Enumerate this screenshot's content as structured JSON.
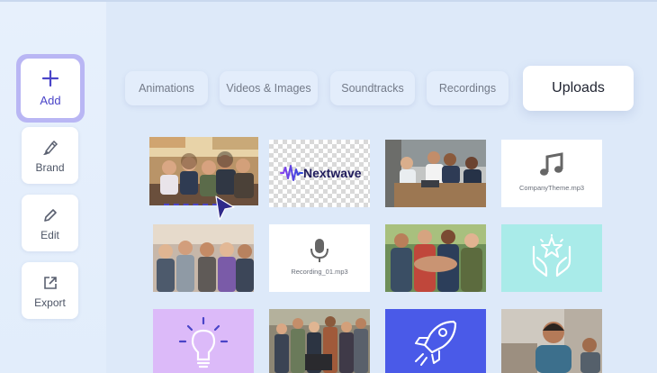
{
  "sidebar": {
    "add_label": "Add",
    "brand_label": "Brand",
    "edit_label": "Edit",
    "export_label": "Export"
  },
  "tabs": [
    {
      "label": "Animations",
      "active": false
    },
    {
      "label": "Videos & Images",
      "active": false
    },
    {
      "label": "Soundtracks",
      "active": false
    },
    {
      "label": "Recordings",
      "active": false
    },
    {
      "label": "Uploads",
      "active": true
    }
  ],
  "uploads": {
    "logo_text": "Nextwave",
    "audio_file": "CompanyTheme.mp3",
    "recording_file": "Recording_01.mp3"
  },
  "colors": {
    "accent": "#4a44c8",
    "accent_ring": "#b9b6f4",
    "mint": "#a9ebe9",
    "lavender": "#dcbaf9",
    "rocket_blue": "#4a5ae8"
  },
  "icons": [
    "plus-icon",
    "brand-icon",
    "edit-icon",
    "export-icon",
    "music-note-icon",
    "microphone-icon",
    "hands-star-icon",
    "lightbulb-icon",
    "rocket-icon",
    "cursor-icon"
  ]
}
